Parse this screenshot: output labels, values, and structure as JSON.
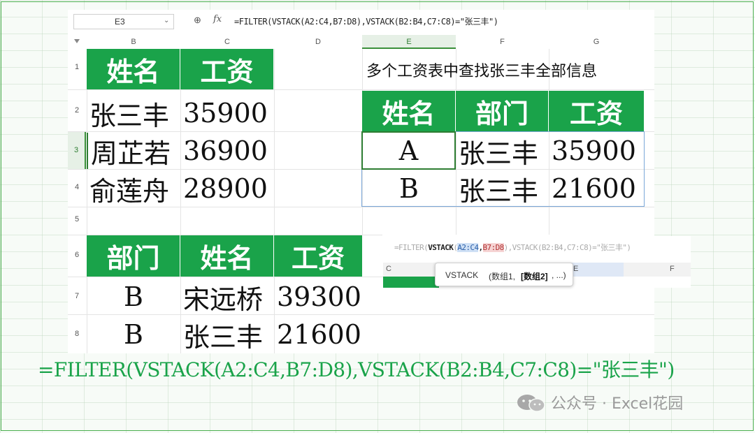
{
  "toolbar": {
    "name_box": "E3",
    "fx_label": "fx",
    "formula": "=FILTER(VSTACK(A2:C4,B7:D8),VSTACK(B2:B4,C7:C8)=\"张三丰\")"
  },
  "columns": [
    "B",
    "C",
    "D",
    "E",
    "F",
    "G"
  ],
  "rows": [
    "1",
    "2",
    "3",
    "4",
    "5",
    "6",
    "7",
    "8"
  ],
  "table1": {
    "headers": [
      "姓名",
      "工资"
    ],
    "rows": [
      [
        "张三丰",
        "35900"
      ],
      [
        "周芷若",
        "36900"
      ],
      [
        "俞莲舟",
        "28900"
      ]
    ]
  },
  "table2": {
    "headers": [
      "部门",
      "姓名",
      "工资"
    ],
    "rows": [
      [
        "B",
        "宋远桥",
        "39300"
      ],
      [
        "B",
        "张三丰",
        "21600"
      ]
    ]
  },
  "result": {
    "title": "多个工资表中查找张三丰全部信息",
    "headers": [
      "姓名",
      "部门",
      "工资"
    ],
    "rows": [
      [
        "A",
        "张三丰",
        "35900"
      ],
      [
        "B",
        "张三丰",
        "21600"
      ]
    ]
  },
  "inset": {
    "formula_prefix": "=FILTER(",
    "fn": "VSTACK",
    "arg1": "A2:C4",
    "comma": ",",
    "arg2_a": "B",
    "arg2_b": "7:D8",
    "formula_rest": "),VSTACK(B2:B4,C7:C8)=\"张三丰\")",
    "col_c": "C",
    "col_e": "E",
    "col_f": "F",
    "tooltip_fn": "VSTACK",
    "tooltip_args_a": "(数组1,",
    "tooltip_args_b": "[数组2]",
    "tooltip_args_c": ", ...)"
  },
  "big_formula": "=FILTER(VSTACK(A2:C4,B7:D8),VSTACK(B2:B4,C7:C8)=\"张三丰\")",
  "watermark": "公众号 · Excel花园",
  "colors": {
    "header_green": "#1aa34a",
    "formula_green": "#1aa34a",
    "active_border": "#2e7d32"
  }
}
